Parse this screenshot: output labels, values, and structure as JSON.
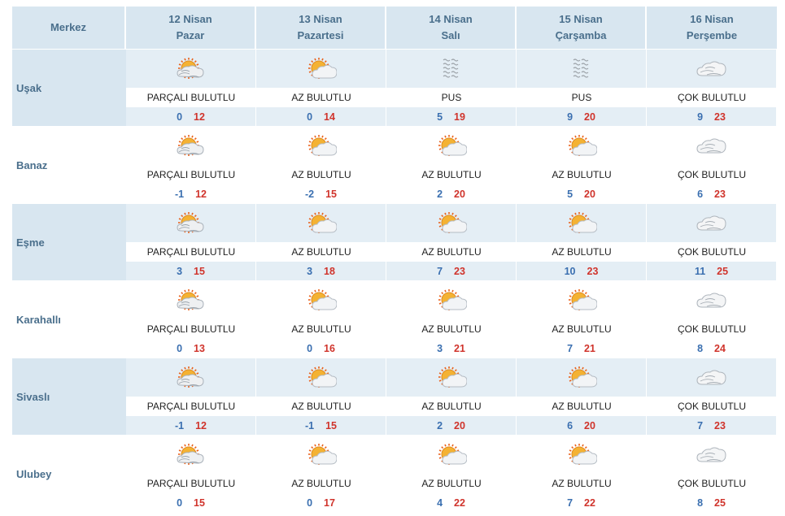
{
  "header": {
    "merkez_label": "Merkez",
    "days": [
      {
        "date": "12 Nisan",
        "weekday": "Pazar"
      },
      {
        "date": "13 Nisan",
        "weekday": "Pazartesi"
      },
      {
        "date": "14 Nisan",
        "weekday": "Salı"
      },
      {
        "date": "15 Nisan",
        "weekday": "Çarşamba"
      },
      {
        "date": "16 Nisan",
        "weekday": "Perşembe"
      }
    ]
  },
  "rows": [
    {
      "city": "Uşak",
      "days": [
        {
          "icon": "partly-cloudy-icon",
          "desc": "PARÇALI BULUTLU",
          "min": "0",
          "max": "12"
        },
        {
          "icon": "mostly-sunny-icon",
          "desc": "AZ BULUTLU",
          "min": "0",
          "max": "14"
        },
        {
          "icon": "haze-icon",
          "desc": "PUS",
          "min": "5",
          "max": "19"
        },
        {
          "icon": "haze-icon",
          "desc": "PUS",
          "min": "9",
          "max": "20"
        },
        {
          "icon": "cloudy-icon",
          "desc": "ÇOK BULUTLU",
          "min": "9",
          "max": "23"
        }
      ]
    },
    {
      "city": "Banaz",
      "days": [
        {
          "icon": "partly-cloudy-icon",
          "desc": "PARÇALI BULUTLU",
          "min": "-1",
          "max": "12"
        },
        {
          "icon": "mostly-sunny-icon",
          "desc": "AZ BULUTLU",
          "min": "-2",
          "max": "15"
        },
        {
          "icon": "mostly-sunny-icon",
          "desc": "AZ BULUTLU",
          "min": "2",
          "max": "20"
        },
        {
          "icon": "mostly-sunny-icon",
          "desc": "AZ BULUTLU",
          "min": "5",
          "max": "20"
        },
        {
          "icon": "cloudy-icon",
          "desc": "ÇOK BULUTLU",
          "min": "6",
          "max": "23"
        }
      ]
    },
    {
      "city": "Eşme",
      "days": [
        {
          "icon": "partly-cloudy-icon",
          "desc": "PARÇALI BULUTLU",
          "min": "3",
          "max": "15"
        },
        {
          "icon": "mostly-sunny-icon",
          "desc": "AZ BULUTLU",
          "min": "3",
          "max": "18"
        },
        {
          "icon": "mostly-sunny-icon",
          "desc": "AZ BULUTLU",
          "min": "7",
          "max": "23"
        },
        {
          "icon": "mostly-sunny-icon",
          "desc": "AZ BULUTLU",
          "min": "10",
          "max": "23"
        },
        {
          "icon": "cloudy-icon",
          "desc": "ÇOK BULUTLU",
          "min": "11",
          "max": "25"
        }
      ]
    },
    {
      "city": "Karahallı",
      "days": [
        {
          "icon": "partly-cloudy-icon",
          "desc": "PARÇALI BULUTLU",
          "min": "0",
          "max": "13"
        },
        {
          "icon": "mostly-sunny-icon",
          "desc": "AZ BULUTLU",
          "min": "0",
          "max": "16"
        },
        {
          "icon": "mostly-sunny-icon",
          "desc": "AZ BULUTLU",
          "min": "3",
          "max": "21"
        },
        {
          "icon": "mostly-sunny-icon",
          "desc": "AZ BULUTLU",
          "min": "7",
          "max": "21"
        },
        {
          "icon": "cloudy-icon",
          "desc": "ÇOK BULUTLU",
          "min": "8",
          "max": "24"
        }
      ]
    },
    {
      "city": "Sivaslı",
      "days": [
        {
          "icon": "partly-cloudy-icon",
          "desc": "PARÇALI BULUTLU",
          "min": "-1",
          "max": "12"
        },
        {
          "icon": "mostly-sunny-icon",
          "desc": "AZ BULUTLU",
          "min": "-1",
          "max": "15"
        },
        {
          "icon": "mostly-sunny-icon",
          "desc": "AZ BULUTLU",
          "min": "2",
          "max": "20"
        },
        {
          "icon": "mostly-sunny-icon",
          "desc": "AZ BULUTLU",
          "min": "6",
          "max": "20"
        },
        {
          "icon": "cloudy-icon",
          "desc": "ÇOK BULUTLU",
          "min": "7",
          "max": "23"
        }
      ]
    },
    {
      "city": "Ulubey",
      "days": [
        {
          "icon": "partly-cloudy-icon",
          "desc": "PARÇALI BULUTLU",
          "min": "0",
          "max": "15"
        },
        {
          "icon": "mostly-sunny-icon",
          "desc": "AZ BULUTLU",
          "min": "0",
          "max": "17"
        },
        {
          "icon": "mostly-sunny-icon",
          "desc": "AZ BULUTLU",
          "min": "4",
          "max": "22"
        },
        {
          "icon": "mostly-sunny-icon",
          "desc": "AZ BULUTLU",
          "min": "7",
          "max": "22"
        },
        {
          "icon": "cloudy-icon",
          "desc": "ÇOK BULUTLU",
          "min": "8",
          "max": "25"
        }
      ]
    }
  ],
  "colors": {
    "header_bg": "#d8e6f0",
    "header_text": "#4a6f8c",
    "min_temp": "#3a6fb0",
    "max_temp": "#d0342c"
  }
}
